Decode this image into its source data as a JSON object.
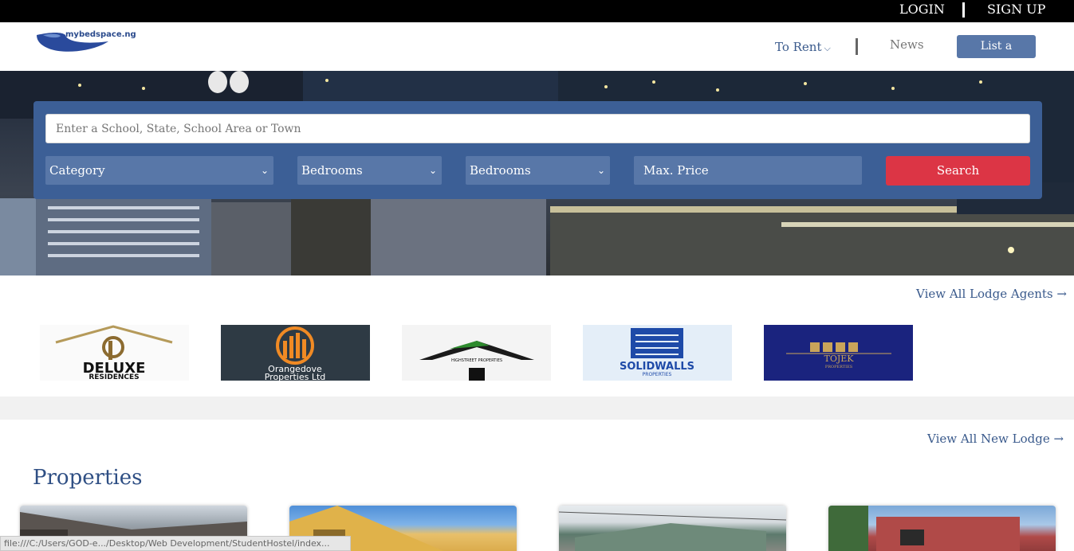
{
  "topbar": {
    "login": "LOGIN",
    "signup": "SIGN UP"
  },
  "header": {
    "logo_text": "mybedspace.ng",
    "nav_rent": "To Rent",
    "nav_news": "News",
    "list_property": "List a Property"
  },
  "search": {
    "placeholder": "Enter a School, State, School Area or Town",
    "category": "Category",
    "bedrooms1": "Bedrooms",
    "bedrooms2": "Bedrooms",
    "max_price_placeholder": "Max. Price",
    "search_button": "Search"
  },
  "agents": {
    "view_all": "View All Lodge Agents",
    "logos": [
      {
        "line1": "DELUXE",
        "line2": "RESIDENCES"
      },
      {
        "line1": "Orangedove",
        "line2": "Properties Ltd"
      },
      {
        "line1": "HIGHSTREET PROPERTIES"
      },
      {
        "line1": "SOLIDWALLS",
        "line2": "PROPERTIES"
      },
      {
        "line1": "TOJEK",
        "line2": "PROPERTIES"
      }
    ]
  },
  "lodges": {
    "view_all": "View All New Lodge"
  },
  "properties": {
    "title": "Properties"
  },
  "status_bar": {
    "url": "file:///C:/Users/GOD-e.../Desktop/Web Development/StudentHostel/index..."
  },
  "colors": {
    "primary": "#3c5f96",
    "accent_blue": "#5877a8",
    "search_red": "#dc3545",
    "link_blue": "#3a5a8c"
  }
}
